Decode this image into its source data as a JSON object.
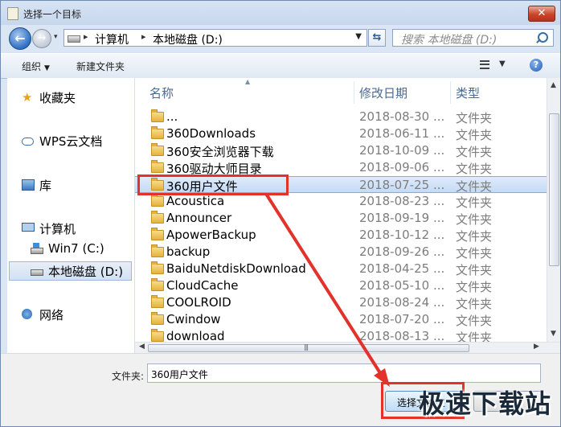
{
  "window": {
    "title": "选择一个目标",
    "close_label": "✕"
  },
  "address": {
    "crumbs": [
      "计算机",
      "本地磁盘 (D:)"
    ],
    "sep": "▸",
    "search_placeholder": "搜索 本地磁盘 (D:)"
  },
  "toolbar": {
    "organize_label": "组织",
    "organize_arrow": "▼",
    "new_folder_label": "新建文件夹",
    "view_arrow": "▼",
    "help_label": "?"
  },
  "nav": {
    "items": [
      {
        "label": "收藏夹",
        "icon": "star-icon"
      },
      {
        "label": "WPS云文档",
        "icon": "cloud-icon"
      },
      {
        "label": "库",
        "icon": "library-icon"
      },
      {
        "label": "计算机",
        "icon": "computer-icon"
      },
      {
        "label": "Win7 (C:)",
        "icon": "drive-icon"
      },
      {
        "label": "本地磁盘 (D:)",
        "icon": "drive-icon",
        "selected": true
      },
      {
        "label": "网络",
        "icon": "network-icon"
      }
    ]
  },
  "columns": {
    "name": "名称",
    "date": "修改日期",
    "type": "类型"
  },
  "files": [
    {
      "name": "...",
      "date": "2018-08-30 ...",
      "type": "文件夹"
    },
    {
      "name": "360Downloads",
      "date": "2018-06-11 ...",
      "type": "文件夹"
    },
    {
      "name": "360安全浏览器下载",
      "date": "2018-10-09 ...",
      "type": "文件夹"
    },
    {
      "name": "360驱动大师目录",
      "date": "2018-09-06 ...",
      "type": "文件夹"
    },
    {
      "name": "360用户文件",
      "date": "2018-07-25 ...",
      "type": "文件夹",
      "selected": true
    },
    {
      "name": "Acoustica",
      "date": "2018-08-23 ...",
      "type": "文件夹"
    },
    {
      "name": "Announcer",
      "date": "2018-09-19 ...",
      "type": "文件夹"
    },
    {
      "name": "ApowerBackup",
      "date": "2018-10-12 ...",
      "type": "文件夹"
    },
    {
      "name": "backup",
      "date": "2018-09-26 ...",
      "type": "文件夹"
    },
    {
      "name": "BaiduNetdiskDownload",
      "date": "2018-04-25 ...",
      "type": "文件夹"
    },
    {
      "name": "CloudCache",
      "date": "2018-05-10 ...",
      "type": "文件夹"
    },
    {
      "name": "COOLROID",
      "date": "2018-08-24 ...",
      "type": "文件夹"
    },
    {
      "name": "Cwindow",
      "date": "2018-07-20 ...",
      "type": "文件夹"
    },
    {
      "name": "download",
      "date": "2018-08-13 ...",
      "type": "文件夹"
    }
  ],
  "footer": {
    "folder_label": "文件夹:",
    "folder_value": "360用户文件",
    "select_button": "选择文件夹",
    "cancel_button": ""
  },
  "watermark": "极速下载站",
  "colors": {
    "highlight": "#e2322b",
    "selection": "#c4dbf5"
  }
}
